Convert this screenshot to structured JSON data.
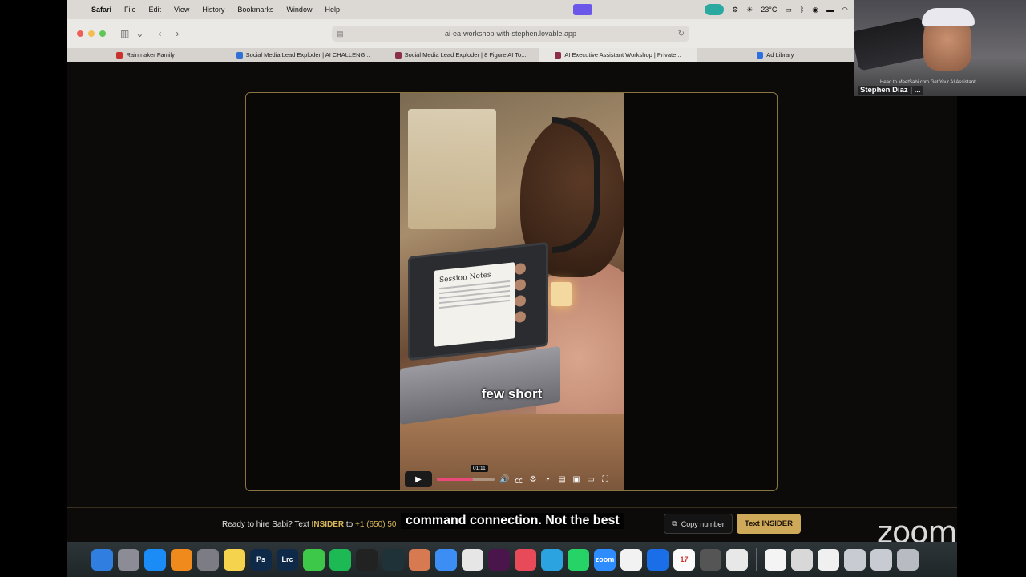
{
  "menubar": {
    "apple": "",
    "items": [
      "Safari",
      "File",
      "Edit",
      "View",
      "History",
      "Bookmarks",
      "Window",
      "Help"
    ],
    "temperature": "23°C"
  },
  "browser": {
    "url": "ai-ea-workshop-with-stephen.lovable.app",
    "tabs": [
      {
        "label": "Rainmaker Family",
        "favicon_color": "#c9322c"
      },
      {
        "label": "Social Media Lead Exploder | AI CHALLENG...",
        "favicon_color": "#2f6fd6"
      },
      {
        "label": "Social Media Lead Exploder | 8 Figure AI To...",
        "favicon_color": "#8a2e4a"
      },
      {
        "label": "AI Executive Assistant Workshop | Private...",
        "favicon_color": "#8a2e4a"
      },
      {
        "label": "Ad Library",
        "favicon_color": "#2d6fe0"
      }
    ]
  },
  "video": {
    "doc_title": "Session Notes",
    "caption": "few short",
    "time_tooltip": "01:11",
    "progress": 0.62
  },
  "footer": {
    "prefix": "Ready to hire Sabi? Text ",
    "keyword": "INSIDER",
    "middle": " to ",
    "phone": "+1 (650) 50",
    "copy_label": "Copy number",
    "text_button": "Text INSIDER"
  },
  "live_caption": "command connection. Not the best",
  "zoom": {
    "participant_name": "Stephen Diaz | ...",
    "banner_text": "Head to MeetSabi.com Get Your AI Assistant",
    "logo": "zoom"
  },
  "dock": {
    "icons": [
      {
        "name": "finder-icon",
        "color": "#2f7ee0",
        "label": ""
      },
      {
        "name": "launchpad-icon",
        "color": "#8c8c96",
        "label": ""
      },
      {
        "name": "app-store-icon",
        "color": "#1b8cf5",
        "label": ""
      },
      {
        "name": "books-icon",
        "color": "#f08a1c",
        "label": ""
      },
      {
        "name": "settings-icon",
        "color": "#7c7c84",
        "label": ""
      },
      {
        "name": "notes-icon",
        "color": "#f5d34d",
        "label": ""
      },
      {
        "name": "photoshop-icon",
        "color": "#0f2a48",
        "label": "Ps"
      },
      {
        "name": "lightroom-icon",
        "color": "#0f2a48",
        "label": "Lrc"
      },
      {
        "name": "messages-icon",
        "color": "#3ec84a",
        "label": ""
      },
      {
        "name": "spotify-icon",
        "color": "#1db954",
        "label": ""
      },
      {
        "name": "chatgpt-icon",
        "color": "#222",
        "label": ""
      },
      {
        "name": "perplexity-icon",
        "color": "#1f3238",
        "label": ""
      },
      {
        "name": "claude-icon",
        "color": "#d77a52",
        "label": ""
      },
      {
        "name": "safari-icon",
        "color": "#3c8ef5",
        "label": ""
      },
      {
        "name": "chrome-icon",
        "color": "#e6e6e6",
        "label": ""
      },
      {
        "name": "slack-icon",
        "color": "#4a154b",
        "label": ""
      },
      {
        "name": "arc-icon",
        "color": "#e94a5a",
        "label": ""
      },
      {
        "name": "telegram-icon",
        "color": "#2aa3e0",
        "label": ""
      },
      {
        "name": "whatsapp-icon",
        "color": "#25d366",
        "label": ""
      },
      {
        "name": "zoom-icon",
        "color": "#2d8cff",
        "label": "zoom"
      },
      {
        "name": "google-drive-icon",
        "color": "#f2f2f2",
        "label": ""
      },
      {
        "name": "1password-icon",
        "color": "#1a6fe8",
        "label": ""
      },
      {
        "name": "calendar-icon",
        "color": "#fafafa",
        "label": "17"
      },
      {
        "name": "calculator-icon",
        "color": "#555",
        "label": ""
      },
      {
        "name": "iphone-mirroring-icon",
        "color": "#e8e8e8",
        "label": ""
      },
      {
        "name": "reminders-icon",
        "color": "#f4f4f4",
        "label": ""
      },
      {
        "name": "preview-icon",
        "color": "#d8d8d8",
        "label": ""
      },
      {
        "name": "textedit-icon",
        "color": "#f0f0f0",
        "label": ""
      },
      {
        "name": "folder-icon",
        "color": "#c8ccd2",
        "label": ""
      },
      {
        "name": "downloads-icon",
        "color": "#c8ccd2",
        "label": ""
      },
      {
        "name": "trash-icon",
        "color": "#b8bcc2",
        "label": ""
      }
    ]
  }
}
